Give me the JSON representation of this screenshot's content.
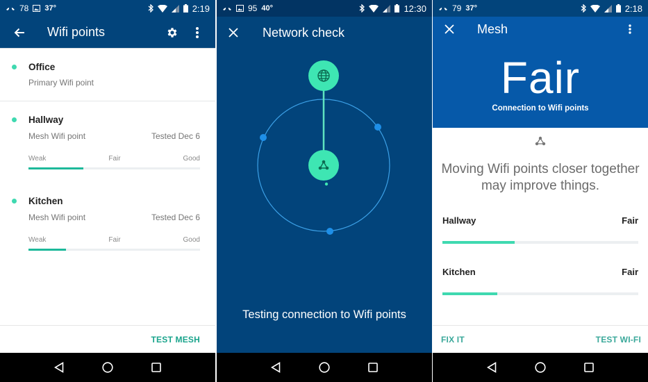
{
  "colors": {
    "primary_dark": "#02447b",
    "primary": "#0659a9",
    "accent": "#3fd9b0",
    "accent_text": "#1aa48c",
    "orbit_dot": "#1e8fe8"
  },
  "screens": [
    {
      "status": {
        "left_number": "78",
        "temp": "37°",
        "time": "2:19"
      },
      "appbar": {
        "title": "Wifi points",
        "back_icon": "arrow-left-icon",
        "settings_icon": "gear-icon",
        "more_icon": "more-vert-icon"
      },
      "points": [
        {
          "name": "Office",
          "type": "Primary Wifi point"
        },
        {
          "name": "Hallway",
          "type": "Mesh Wifi point",
          "tested": "Tested Dec 6",
          "scale": [
            "Weak",
            "Fair",
            "Good"
          ],
          "strength_pct": 32
        },
        {
          "name": "Kitchen",
          "type": "Mesh Wifi point",
          "tested": "Tested Dec 6",
          "scale": [
            "Weak",
            "Fair",
            "Good"
          ],
          "strength_pct": 22
        }
      ],
      "footer": {
        "action": "TEST MESH"
      }
    },
    {
      "status": {
        "left_number": "95",
        "temp": "40°",
        "time": "12:30"
      },
      "appbar": {
        "title": "Network check",
        "close_icon": "close-icon"
      },
      "diagram": {
        "top_node_icon": "globe-icon",
        "center_node_icon": "mesh-network-icon"
      },
      "message": "Testing connection to Wifi points"
    },
    {
      "status": {
        "left_number": "79",
        "temp": "37°",
        "time": "2:18"
      },
      "appbar": {
        "title": "Mesh",
        "close_icon": "close-icon",
        "more_icon": "more-vert-icon"
      },
      "hero": {
        "rating": "Fair",
        "caption": "Connection to Wifi points"
      },
      "message": "Moving Wifi points closer together may improve things.",
      "rows": [
        {
          "name": "Hallway",
          "rating": "Fair",
          "strength_pct": 37
        },
        {
          "name": "Kitchen",
          "rating": "Fair",
          "strength_pct": 28
        }
      ],
      "footer": {
        "left_action": "FIX IT",
        "right_action": "TEST WI-FI"
      }
    }
  ],
  "navbar": {
    "back": "nav-back-icon",
    "home": "nav-home-icon",
    "recents": "nav-recents-icon"
  }
}
